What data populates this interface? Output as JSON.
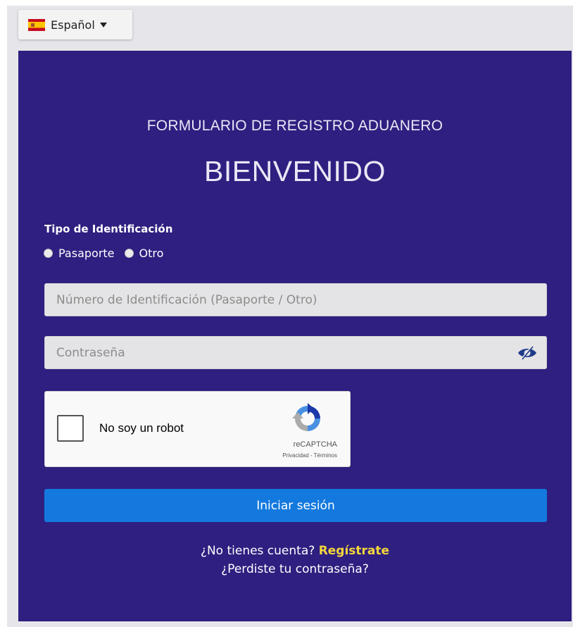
{
  "language": {
    "selected": "Español",
    "flag_icon": "spain-flag-icon"
  },
  "form": {
    "subtitle": "FORMULARIO DE REGISTRO ADUANERO",
    "title": "BIENVENIDO",
    "id_type": {
      "label": "Tipo de Identificación",
      "options": [
        "Pasaporte",
        "Otro"
      ]
    },
    "id_number": {
      "placeholder": "Número de Identificación (Pasaporte / Otro)",
      "value": ""
    },
    "password": {
      "placeholder": "Contraseña",
      "value": "",
      "toggle_icon": "eye-slash-icon"
    },
    "captcha": {
      "label": "No soy un robot",
      "brand": "reCAPTCHA",
      "links": "Privacidad - Términos"
    },
    "login_button": "Iniciar sesión",
    "signup_prompt": "¿No tienes cuenta?",
    "signup_link": "Regístrate",
    "forgot_password": "¿Perdiste tu contraseña?"
  },
  "colors": {
    "panel": "#2e1f80",
    "button": "#1479de",
    "link_accent": "#f5d63b"
  }
}
